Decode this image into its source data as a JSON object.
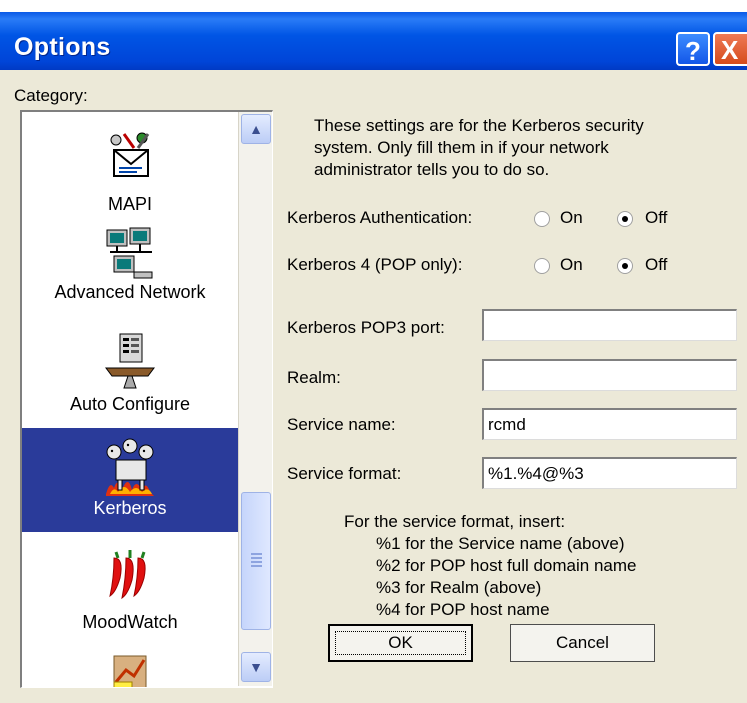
{
  "window": {
    "title": "Options",
    "help_glyph": "?",
    "close_glyph": "X",
    "accent": "#0055e5"
  },
  "category_label": "Category:",
  "categories": [
    {
      "label": "MAPI",
      "icon": "mapi-icon",
      "selected": false
    },
    {
      "label": "Advanced Network",
      "icon": "network-icon",
      "selected": false
    },
    {
      "label": "Auto Configure",
      "icon": "auto-configure-icon",
      "selected": false
    },
    {
      "label": "Kerberos",
      "icon": "kerberos-dog-icon",
      "selected": true
    },
    {
      "label": "MoodWatch",
      "icon": "chili-peppers-icon",
      "selected": false
    },
    {
      "label": "",
      "icon": "chart-icon",
      "selected": false
    }
  ],
  "description": [
    "These settings are for the Kerberos security",
    "system. Only fill them in if your network",
    "administrator tells you to do so."
  ],
  "kerberos_auth": {
    "label": "Kerberos Authentication:",
    "on_label": "On",
    "off_label": "Off",
    "value": "Off"
  },
  "kerberos4": {
    "label": "Kerberos 4 (POP only):",
    "on_label": "On",
    "off_label": "Off",
    "value": "Off"
  },
  "fields": {
    "pop3_port": {
      "label": "Kerberos POP3 port:",
      "value": ""
    },
    "realm": {
      "label": "Realm:",
      "value": ""
    },
    "service_name": {
      "label": "Service name:",
      "value": "rcmd"
    },
    "service_format": {
      "label": "Service format:",
      "value": "%1.%4@%3"
    }
  },
  "format_help": {
    "title": "For the service format, insert:",
    "lines": [
      "%1 for the Service name (above)",
      "%2 for POP host full domain name",
      "%3 for Realm (above)",
      "%4 for POP host name"
    ]
  },
  "buttons": {
    "ok": "OK",
    "cancel": "Cancel"
  },
  "scrollbar": {
    "up_glyph": "▲",
    "down_glyph": "▼"
  }
}
